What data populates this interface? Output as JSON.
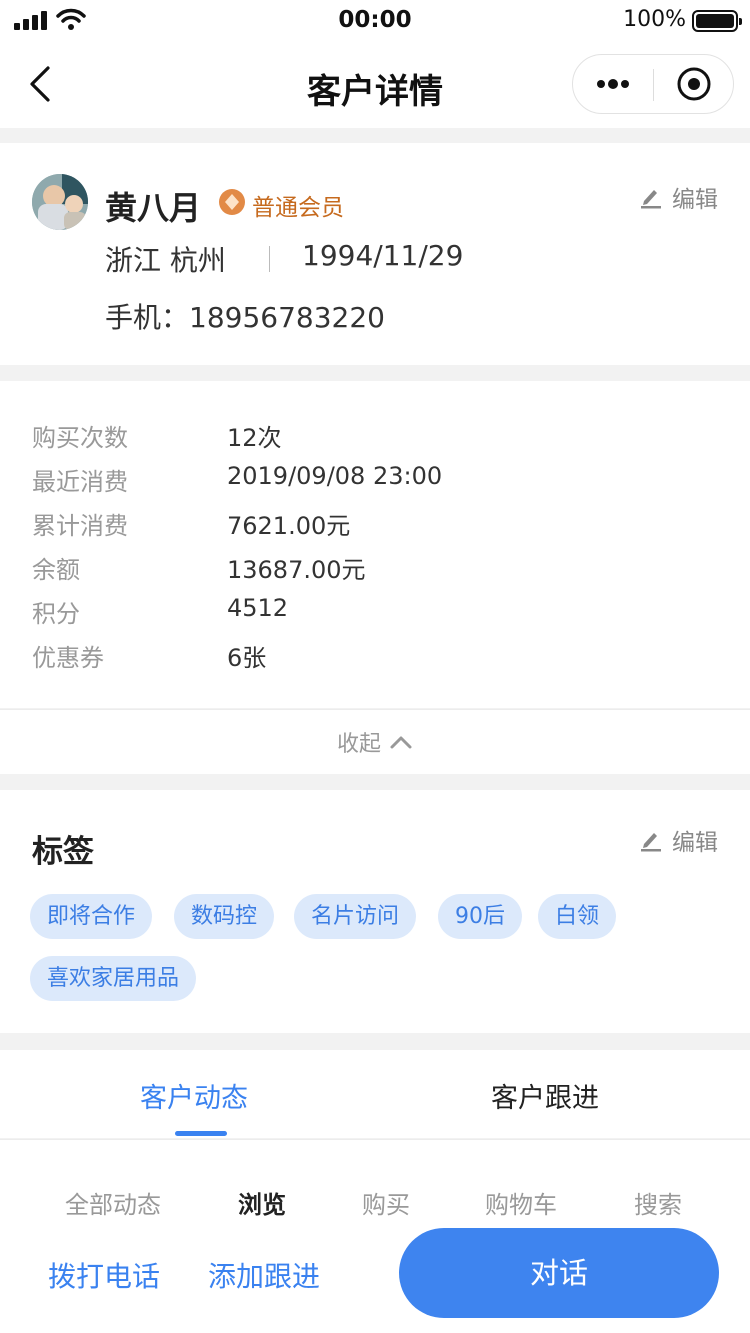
{
  "status_bar": {
    "time": "00:00",
    "battery": "100%"
  },
  "nav": {
    "title": "客户详情"
  },
  "profile": {
    "name": "黄八月",
    "level": "普通会员",
    "edit_label": "编辑",
    "location": "浙江 杭州",
    "birthday": "1994/11/29",
    "phone": "手机：18956783220"
  },
  "info": {
    "rows": [
      {
        "label": "购买次数",
        "value": "12次"
      },
      {
        "label": "最近消费",
        "value": "2019/09/08 23:00"
      },
      {
        "label": "累计消费",
        "value": "7621.00元"
      },
      {
        "label": "余额",
        "value": "13687.00元"
      },
      {
        "label": "积分",
        "value": "4512"
      },
      {
        "label": "优惠券",
        "value": "6张"
      }
    ],
    "collapse_label": "收起"
  },
  "tags": {
    "title": "标签",
    "edit_label": "编辑",
    "items": [
      "即将合作",
      "数码控",
      "名片访问",
      "90后",
      "白领",
      "喜欢家居用品"
    ]
  },
  "tabs": {
    "items": [
      "客户动态",
      "客户跟进"
    ],
    "active": 0
  },
  "subtabs": {
    "items": [
      "全部动态",
      "浏览",
      "购买",
      "购物车",
      "搜索"
    ],
    "active": 1
  },
  "actions": {
    "call": "拨打电话",
    "add_follow": "添加跟进",
    "chat": "对话"
  },
  "colors": {
    "accent": "#3a82f0",
    "tag_bg": "#dce9fb",
    "level": "#c66a1e"
  }
}
